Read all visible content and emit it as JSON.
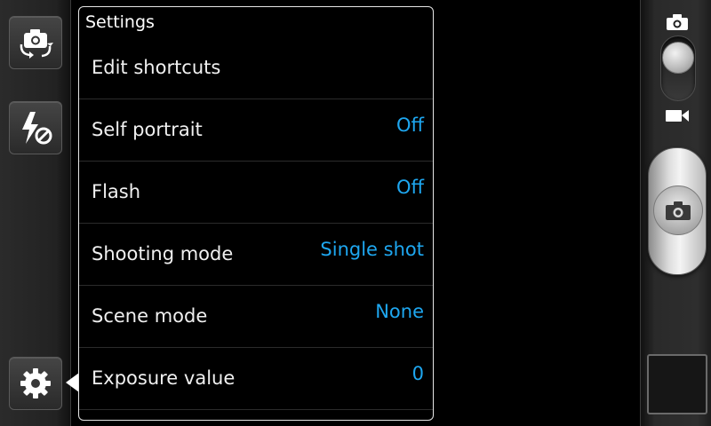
{
  "settings_panel": {
    "title": "Settings",
    "rows": [
      {
        "label": "Edit shortcuts",
        "value": ""
      },
      {
        "label": "Self portrait",
        "value": "Off"
      },
      {
        "label": "Flash",
        "value": "Off"
      },
      {
        "label": "Shooting mode",
        "value": "Single shot"
      },
      {
        "label": "Scene mode",
        "value": "None"
      },
      {
        "label": "Exposure value",
        "value": "0"
      }
    ]
  },
  "left_toolbar": {
    "icons": [
      "camera-switch-icon",
      "flash-off-icon",
      "gear-icon"
    ]
  },
  "right_bar": {
    "icons": [
      "camera-mode-icon",
      "video-mode-icon",
      "shutter-camera-icon"
    ],
    "mode_selected": "camera"
  },
  "colors": {
    "value_accent": "#1ea7f0",
    "panel_border": "#e6e6e6"
  }
}
